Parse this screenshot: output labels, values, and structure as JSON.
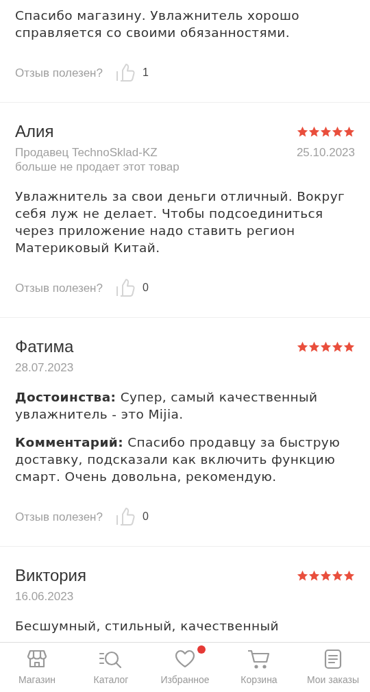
{
  "reviews": [
    {
      "paragraphs": [
        "Спасибо магазину. Увлажнитель хорошо справляется со своими обязанностями."
      ],
      "helpful": {
        "label": "Отзыв полезен?",
        "count": "1"
      }
    },
    {
      "name": "Алия",
      "stars": 5,
      "seller_note": [
        "Продавец TechnoSklad-KZ",
        "больше не продает этот товар"
      ],
      "date": "25.10.2023",
      "paragraphs": [
        "Увлажнитель за свои деньги отличный. Вокруг себя луж не делает. Чтобы подсоединиться через приложение надо ставить регион Материковый Китай."
      ],
      "helpful": {
        "label": "Отзыв полезен?",
        "count": "0"
      }
    },
    {
      "name": "Фатима",
      "stars": 5,
      "date": "28.07.2023",
      "paragraphs": [
        "**Достоинства:** Супер, самый качественный увлажнитель - это Mijia.",
        "**Комментарий:** Спасибо продавцу за быструю доставку, подсказали как включить функцию смарт. Очень довольна, рекомендую."
      ],
      "helpful": {
        "label": "Отзыв полезен?",
        "count": "0"
      }
    },
    {
      "name": "Виктория",
      "stars": 5,
      "date": "16.06.2023",
      "paragraphs": [
        "Бесшумный, стильный, качественный"
      ]
    }
  ],
  "nav": [
    {
      "kind": "shop",
      "label": "Магазин",
      "badge": false
    },
    {
      "kind": "catalog",
      "label": "Каталог",
      "badge": false
    },
    {
      "kind": "favorites",
      "label": "Избранное",
      "badge": true
    },
    {
      "kind": "cart",
      "label": "Корзина",
      "badge": false
    },
    {
      "kind": "orders",
      "label": "Мои заказы",
      "badge": false
    }
  ]
}
